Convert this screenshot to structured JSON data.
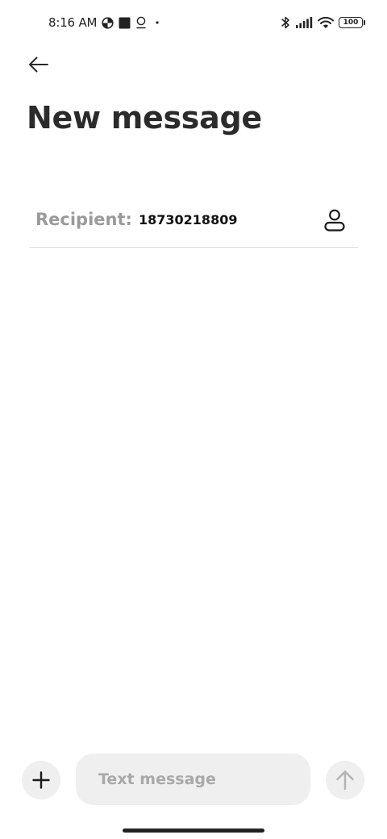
{
  "status_bar": {
    "time": "8:16 AM",
    "left_icons": [
      "data-saver-icon",
      "square-notification-icon",
      "location-badge-icon",
      "dot-icon"
    ],
    "right_icons": [
      "bluetooth-icon",
      "signal-icon",
      "wifi-icon"
    ],
    "battery": "100"
  },
  "header": {
    "back_icon": "arrow-left-icon",
    "title": "New message"
  },
  "recipient": {
    "label": "Recipient:",
    "value": "18730218809",
    "contact_icon": "person-icon"
  },
  "composer": {
    "attach_icon": "plus-icon",
    "placeholder": "Text message",
    "send_icon": "arrow-up-icon"
  },
  "colors": {
    "background": "#ffffff",
    "text": "#2b2b2b",
    "muted": "#9a9a9a",
    "field_bg": "#efefef",
    "divider": "#dcdcdc"
  }
}
